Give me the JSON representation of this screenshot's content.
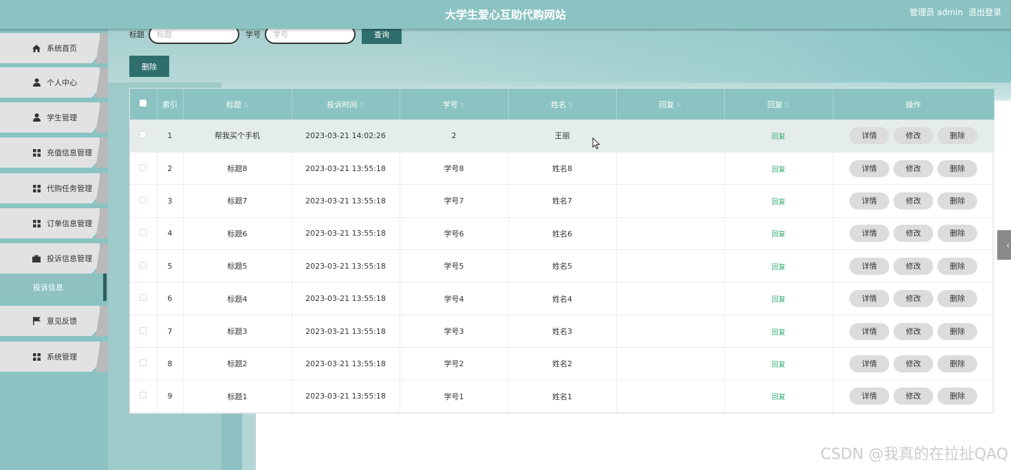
{
  "header": {
    "site_title": "大学生爱心互助代购网站",
    "user": "管理员 admin",
    "logout": "退出登录"
  },
  "sidebar": {
    "items": [
      {
        "label": "系统首页",
        "icon": "home-icon"
      },
      {
        "label": "个人中心",
        "icon": "user-icon"
      },
      {
        "label": "学生管理",
        "icon": "user-icon"
      },
      {
        "label": "充值信息管理",
        "icon": "grid-icon"
      },
      {
        "label": "代购任务管理",
        "icon": "grid-icon"
      },
      {
        "label": "订单信息管理",
        "icon": "grid-icon"
      },
      {
        "label": "投诉信息管理",
        "icon": "briefcase-icon"
      },
      {
        "label": "意见反馈",
        "icon": "flag-icon"
      },
      {
        "label": "系统管理",
        "icon": "grid-icon"
      }
    ],
    "active_sub": "投诉信息"
  },
  "search": {
    "title_label": "标题",
    "title_placeholder": "标题",
    "student_label": "学号",
    "student_placeholder": "学号",
    "query_button": "查询",
    "delete_button": "删除"
  },
  "table": {
    "columns": [
      "索引",
      "标题",
      "投诉时间",
      "学号",
      "姓名",
      "回复",
      "回复",
      "操作"
    ],
    "rows": [
      {
        "index": "1",
        "title": "帮我买个手机",
        "time": "2023-03-21 14:02:26",
        "student_no": "2",
        "name": "王丽",
        "reply": "",
        "reply_link": "回复"
      },
      {
        "index": "2",
        "title": "标题8",
        "time": "2023-03-21 13:55:18",
        "student_no": "学号8",
        "name": "姓名8",
        "reply": "",
        "reply_link": "回复"
      },
      {
        "index": "3",
        "title": "标题7",
        "time": "2023-03-21 13:55:18",
        "student_no": "学号7",
        "name": "姓名7",
        "reply": "",
        "reply_link": "回复"
      },
      {
        "index": "4",
        "title": "标题6",
        "time": "2023-03-21 13:55:18",
        "student_no": "学号6",
        "name": "姓名6",
        "reply": "",
        "reply_link": "回复"
      },
      {
        "index": "5",
        "title": "标题5",
        "time": "2023-03-21 13:55:18",
        "student_no": "学号5",
        "name": "姓名5",
        "reply": "",
        "reply_link": "回复"
      },
      {
        "index": "6",
        "title": "标题4",
        "time": "2023-03-21 13:55:18",
        "student_no": "学号4",
        "name": "姓名4",
        "reply": "",
        "reply_link": "回复"
      },
      {
        "index": "7",
        "title": "标题3",
        "time": "2023-03-21 13:55:18",
        "student_no": "学号3",
        "name": "姓名3",
        "reply": "",
        "reply_link": "回复"
      },
      {
        "index": "8",
        "title": "标题2",
        "time": "2023-03-21 13:55:18",
        "student_no": "学号2",
        "name": "姓名2",
        "reply": "",
        "reply_link": "回复"
      },
      {
        "index": "9",
        "title": "标题1",
        "time": "2023-03-21 13:55:18",
        "student_no": "学号1",
        "name": "姓名1",
        "reply": "",
        "reply_link": "回复"
      }
    ],
    "actions": {
      "detail": "详情",
      "edit": "修改",
      "delete": "删除"
    }
  },
  "watermark": "CSDN @我真的在拉扯QAQ",
  "colors": {
    "accent": "#8ac3c2",
    "dark_button": "#2e6f6d",
    "reply_link": "#2eaa6e"
  }
}
